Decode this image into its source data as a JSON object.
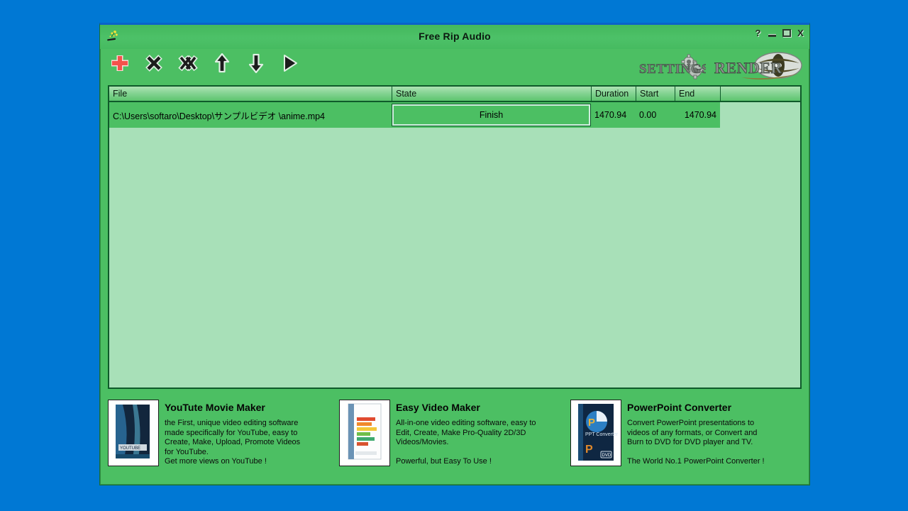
{
  "desktop": {
    "background_color": "#0078d4"
  },
  "window": {
    "title": "Free Rip Audio",
    "icon": "sparkle-wand-icon",
    "background_color": "#4cbf63",
    "caption_buttons": [
      {
        "name": "help-button",
        "glyph": "?"
      },
      {
        "name": "minimize-button",
        "glyph": "—"
      },
      {
        "name": "maximize-button",
        "glyph": "□"
      },
      {
        "name": "close-button",
        "glyph": "X"
      }
    ]
  },
  "toolbar": {
    "items": [
      {
        "name": "add-file-button",
        "icon": "plus-icon",
        "color": "#f4524b"
      },
      {
        "name": "remove-file-button",
        "icon": "close-x-icon",
        "color": "#202020"
      },
      {
        "name": "remove-all-files-button",
        "icon": "double-x-icon",
        "color": "#202020"
      },
      {
        "name": "move-up-button",
        "icon": "arrow-up-icon",
        "color": "#202020"
      },
      {
        "name": "move-down-button",
        "icon": "arrow-down-icon",
        "color": "#202020"
      },
      {
        "name": "play-button",
        "icon": "play-triangle-icon",
        "color": "#202020"
      }
    ],
    "settings_label": "SETTINGS",
    "render_label": "RENDER"
  },
  "file_list": {
    "columns": [
      {
        "key": "file",
        "label": "File"
      },
      {
        "key": "state",
        "label": "State"
      },
      {
        "key": "duration",
        "label": "Duration"
      },
      {
        "key": "start",
        "label": "Start"
      },
      {
        "key": "end",
        "label": "End"
      }
    ],
    "rows": [
      {
        "file": "C:\\Users\\softaro\\Desktop\\サンプルビデオ \\anime.mp4",
        "state": "Finish",
        "duration": "1470.94",
        "start": "0.00",
        "end": "1470.94"
      }
    ],
    "background_color": "#a8e0b8",
    "row_color": "#4cbf63"
  },
  "ads": [
    {
      "name": "ad-youtube-movie-maker",
      "title": "YouTute Movie Maker",
      "description": "the First, unique video editing software\nmade specifically for YouTube, easy to\nCreate, Make, Upload, Promote Videos\nfor YouTube.\nGet more views on YouTube !",
      "thumb": "youtube-movie-maker-box-art"
    },
    {
      "name": "ad-easy-video-maker",
      "title": "Easy Video Maker",
      "description": "All-in-one video editing software, easy to\nEdit, Create, Make Pro-Quality 2D/3D\nVideos/Movies.\n\nPowerful, but Easy To Use !",
      "thumb": "easy-video-maker-box-art"
    },
    {
      "name": "ad-powerpoint-converter",
      "title": "PowerPoint Converter",
      "description": "Convert PowerPoint presentations to\nvideos of any formats, or Convert and\nBurn to DVD for DVD player and TV.\n\nThe World No.1 PowerPoint Converter !",
      "thumb": "powerpoint-converter-box-art"
    }
  ]
}
